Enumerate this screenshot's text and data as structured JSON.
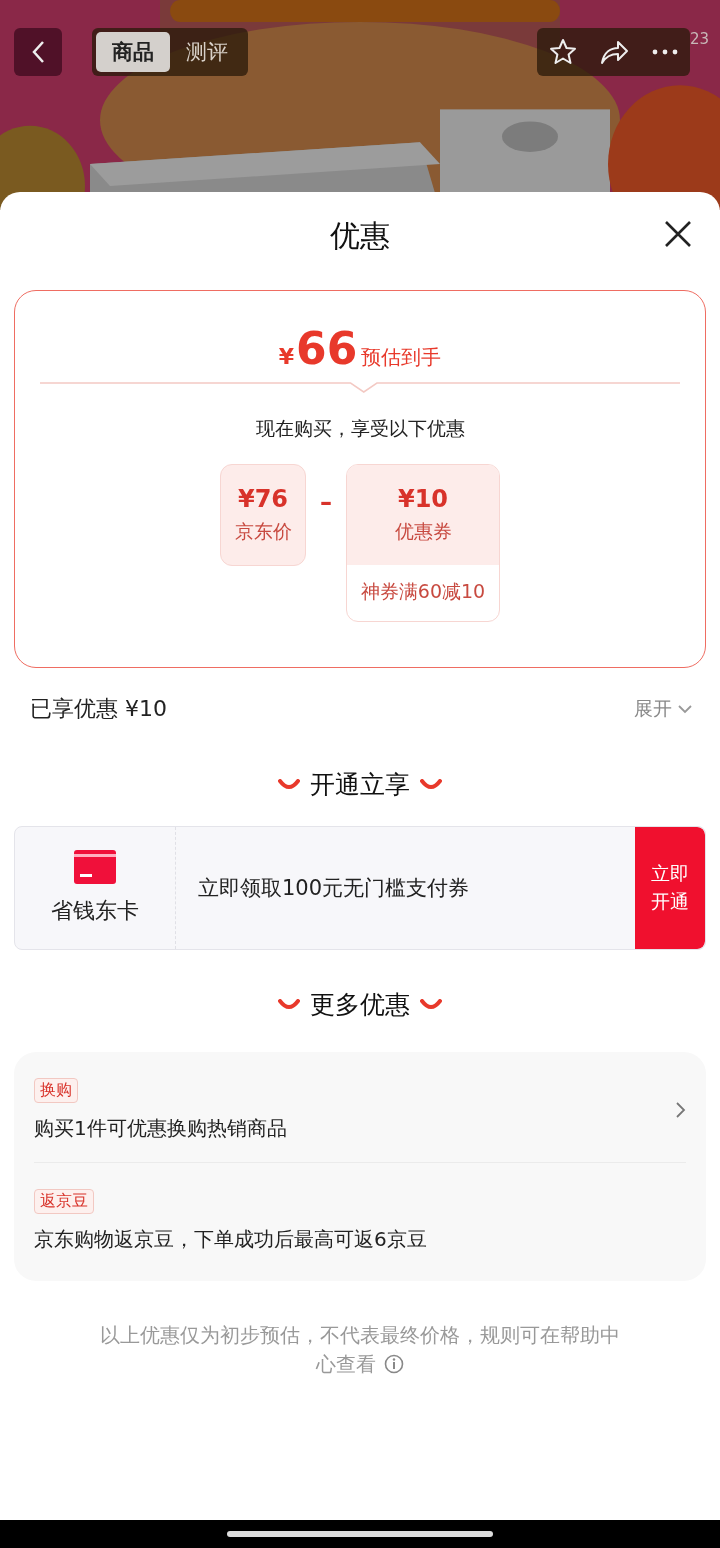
{
  "top_bar": {
    "tabs": [
      {
        "label": "商品",
        "selected": true
      },
      {
        "label": "测评",
        "selected": false
      }
    ],
    "actions": [
      {
        "kind": "star"
      },
      {
        "kind": "share"
      },
      {
        "kind": "more"
      }
    ],
    "corner_count": "23"
  },
  "sheet": {
    "title": "优惠"
  },
  "estimate": {
    "currency": "¥",
    "amount": "66",
    "label": "预估到手",
    "subtitle": "现在购买，享受以下优惠",
    "terms": [
      {
        "kind": "price",
        "amount": "¥76",
        "label": "京东价"
      },
      {
        "kind": "operator",
        "symbol": "–"
      },
      {
        "kind": "coupon",
        "amount": "¥10",
        "label": "优惠券",
        "note": "神券满60减10"
      }
    ]
  },
  "enjoyed": {
    "label": "已享优惠 ¥10",
    "toggle": "展开",
    "expanded": false
  },
  "open_section": {
    "heading": "开通立享",
    "card": {
      "name": "省钱东卡",
      "offer": "立即领取100元无门槛支付券",
      "action": "立即开通"
    }
  },
  "more_section": {
    "heading": "更多优惠",
    "items": [
      {
        "tag": "换购",
        "text": "购买1件可优惠换购热销商品",
        "linked": true
      },
      {
        "tag": "返京豆",
        "text": "京东购物返京豆，下单成功后最高可返6京豆",
        "linked": false
      }
    ]
  },
  "disclaimer": "以上优惠仅为初步预估，不代表最终价格，规则可在帮助中心查看"
}
